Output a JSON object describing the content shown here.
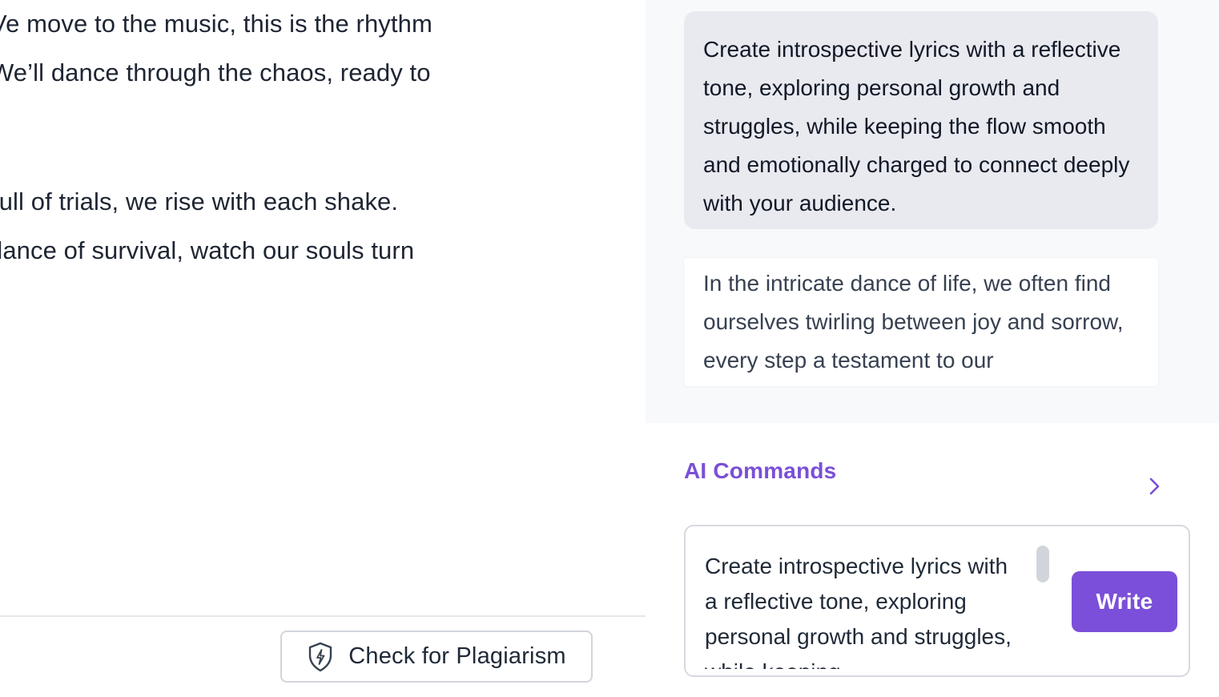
{
  "editor": {
    "lines": [
      "Ve move to the music, this is the rhythm",
      "We’ll dance through the chaos, ready to",
      "full of trials, we rise with each shake.",
      "dance of survival, watch our souls turn"
    ],
    "plagiarism_button_label": "Check for Plagiarism",
    "plagiarism_icon": "shield-lightning-icon"
  },
  "chat": {
    "prompt": "Create introspective lyrics with a reflective tone, exploring personal growth and struggles, while keeping the flow smooth and emotionally charged to connect deeply with your audience.",
    "response": "In the intricate dance of life, we often find ourselves twirling between joy and sorrow, every step a testament to our"
  },
  "ai_commands": {
    "title": "AI Commands",
    "chevron_icon": "chevron-right-icon",
    "input_value": "Create introspective lyrics with a reflective tone, exploring personal growth and struggles, while keeping",
    "write_label": "Write"
  },
  "colors": {
    "accent": "#7b4fd9",
    "accent_text": "#7a4fd6",
    "prompt_bubble_bg": "#e9eaef",
    "chat_bg": "#f8f9fb"
  }
}
